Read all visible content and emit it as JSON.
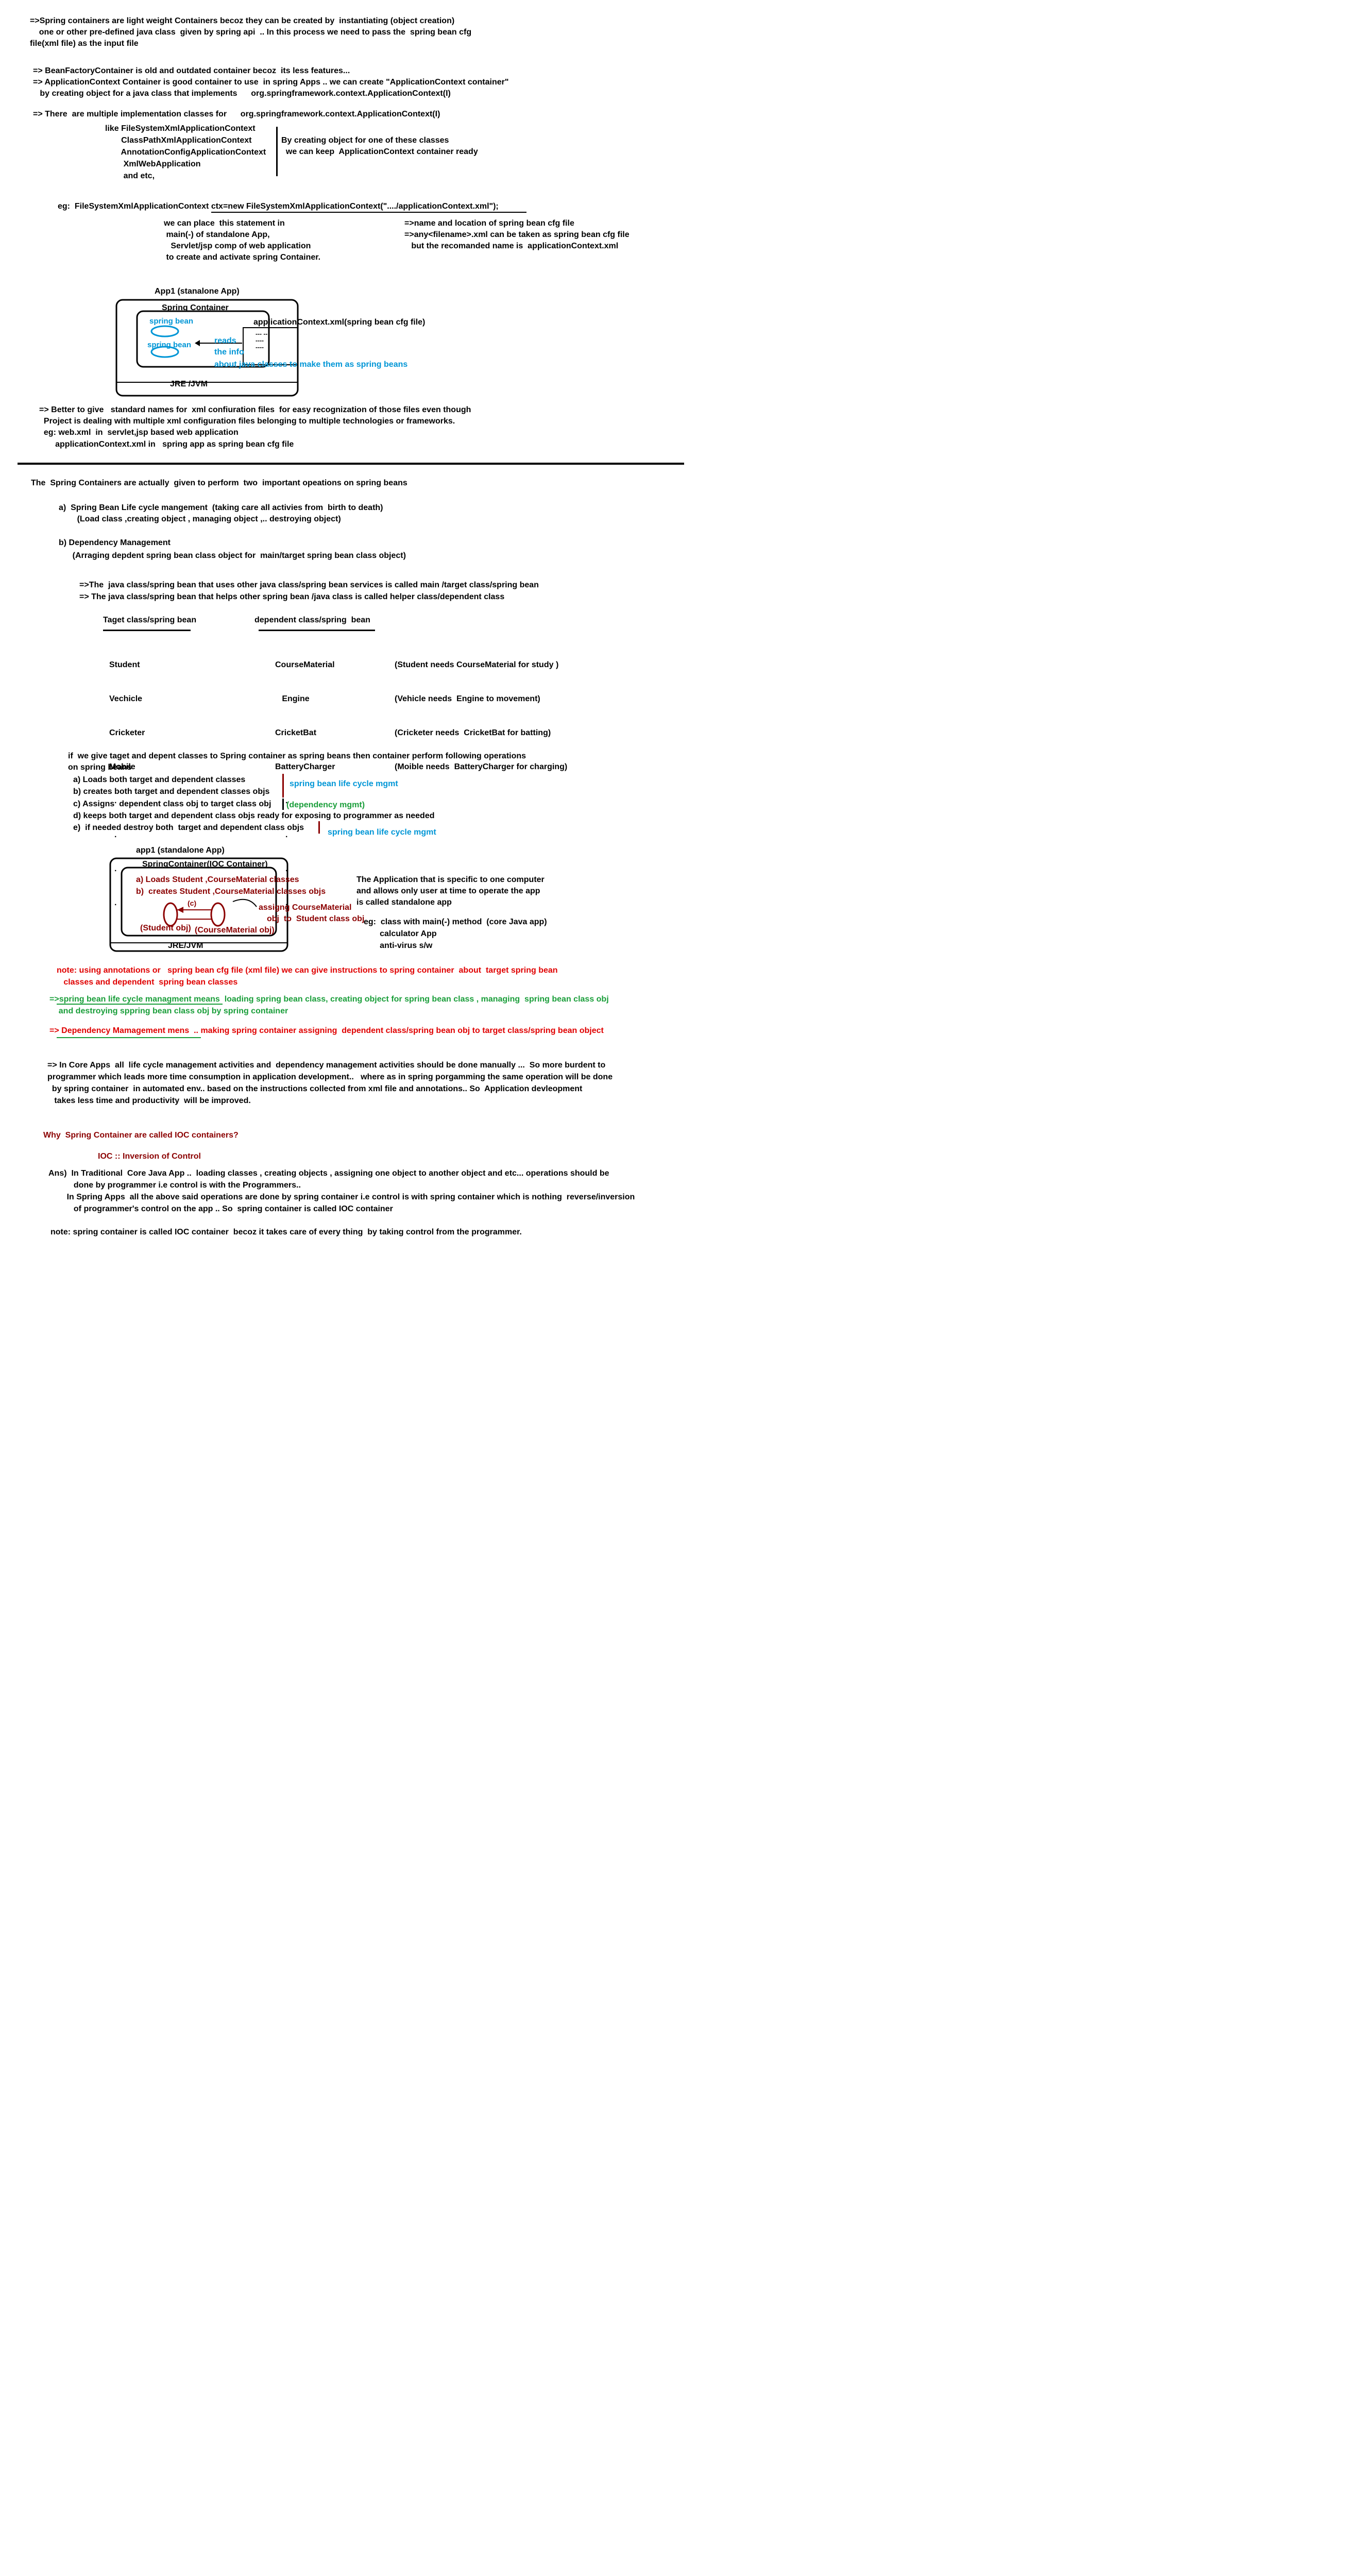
{
  "section1": {
    "intro": [
      "=>Spring containers are light weight Containers becoz they can be created by  instantiating (object creation)",
      "    one or other pre-defined java class  given by spring api  .. In this process we need to pass the  spring bean cfg",
      "file(xml file) as the input file"
    ],
    "bean_factory": [
      "=> BeanFactoryContainer is old and outdated container becoz  its less features...",
      "=> ApplicationContext Container is good container to use  in spring Apps .. we can create \"ApplicationContext container\"",
      "   by creating object for a java class that implements      org.springframework.context.ApplicationContext(I)"
    ],
    "multiple_impl": "=> There  are multiple implementation classes for      org.springframework.context.ApplicationContext(I)",
    "impl_classes": [
      "like FileSystemXmlApplicationContext",
      "       ClassPathXmlApplicationContext",
      "       AnnotationConfigApplicationContext",
      "        XmlWebApplication",
      "        and etc,"
    ],
    "impl_note": [
      "By creating object for one of these classes",
      "  we can keep  ApplicationContext container ready"
    ],
    "eg_statement": "eg:  FileSystemXmlApplicationContext ctx=new FileSystemXmlApplicationContext(\"..../applicationContext.xml\");",
    "eg_place": [
      "we can place  this statement in",
      " main(-) of standalone App,",
      "   Servlet/jsp comp of web application",
      " to create and activate spring Container."
    ],
    "eg_name": [
      "=>name and location of spring bean cfg file",
      "=>any<filename>.xml can be taken as spring bean cfg file",
      "   but the recomanded name is  applicationContext.xml"
    ],
    "diagram1": {
      "app_title": "App1 (stanalone App)",
      "container_label": "Spring Container",
      "bean1": "spring bean",
      "bean2": "spring bean",
      "xml_label": "applicationContext.xml(spring bean cfg file)",
      "reads": "reads",
      "the_info": "the info",
      "note": "about java classes to make them as spring beans",
      "xml_dots": "--- --\n---- \n----",
      "jre": "JRE /JVM"
    },
    "better_names": [
      "=> Better to give   standard names for  xml confiuration files  for easy recognization of those files even though",
      "  Project is dealing with multiple xml configuration files belonging to multiple technologies or frameworks.",
      "  eg: web.xml  in  servlet,jsp based web application",
      "       applicationContext.xml in   spring app as spring bean cfg file"
    ]
  },
  "section2": {
    "heading": "The  Spring Containers are actually  given to perform  two  important opeations on spring beans",
    "op_a": [
      "a)  Spring Bean Life cycle mangement  (taking care all activies from  birth to death)",
      "        (Load class ,creating object , managing object ,.. destroying object)"
    ],
    "op_b": [
      "b) Dependency Management",
      "      (Arraging depdent spring bean class object for  main/target spring bean class object)"
    ],
    "main_def": [
      "=>The  java class/spring bean that uses other java class/spring bean services is called main /target class/spring bean",
      "=> The java class/spring bean that helps other spring bean /java class is called helper class/dependent class"
    ],
    "table": {
      "col1_header": "Taget class/spring bean",
      "col2_header": "dependent class/spring  bean",
      "col1": [
        "Student",
        "Vechicle",
        "Cricketer",
        "Mobile",
        ".",
        ".",
        ".",
        "."
      ],
      "col2": [
        "CourseMaterial",
        "   Engine",
        "CricketBat",
        "BatteryCharger",
        ".",
        ".",
        ".",
        "."
      ],
      "col3": [
        "(Student needs CourseMaterial for study )",
        "(Vehicle needs  Engine to movement)",
        "(Cricketer needs  CricketBat for batting)",
        "(Moible needs  BatteryCharger for charging)"
      ]
    },
    "tasks_intro": [
      "if  we give taget and depent classes to Spring container as spring beans then container perform following operations",
      "on spring beans"
    ],
    "tasks": [
      "a) Loads both target and dependent classes",
      "b) creates both target and dependent classes objs",
      "c) Assigns  dependent class obj to target class obj",
      "d) keeps both target and dependent class objs ready for exposing to programmer as needed",
      "e)  if needed destroy both  target and dependent class objs"
    ],
    "task_notes": {
      "lifecycle1": "spring bean life cycle mgmt",
      "dependency": "(dependency mgmt)",
      "lifecycle2": "spring bean life cycle mgmt"
    },
    "diagram2": {
      "app_title": "app1 (standalone App)",
      "container_label": "SpringContainer(IOC Container)",
      "line_a": "a) Loads Student ,CourseMaterial classes",
      "line_b": "b)  creates Student ,CourseMaterial classes objs",
      "c_label": "(c)",
      "assign": "assigng CourseMaterial",
      "assign2": "obj  to  Student class obj",
      "student_obj": "(Student obj)",
      "course_obj": "(CourseMaterial obj)",
      "jre": "JRE/JVM"
    },
    "standalone_note": [
      "The Application that is specific to one computer",
      "and allows only user at time to operate the app",
      "is called standalone app"
    ],
    "standalone_eg": [
      "eg:  class with main(-) method  (core Java app)",
      "       calculator App",
      "       anti-virus s/w"
    ],
    "note_annotations": [
      "note: using annotations or   spring bean cfg file (xml file) we can give instructions to spring container  about  target spring bean",
      "   classes and dependent  spring bean classes"
    ],
    "lifecycle_means": [
      "=>spring bean life cycle managment means  loading spring bean class, creating object for spring bean class , managing  spring bean class obj",
      "    and destroying sppring bean class obj by spring container"
    ],
    "dependency_means": "=> Dependency Mamagement mens  .. making spring container assigning  dependent class/spring bean obj to target class/spring bean object",
    "core_apps": [
      "=> In Core Apps  all  life cycle management activities and  dependency management activities should be done manually ...  So more burdent to",
      "programmer which leads more time consumption in application development..   where as in spring porgamming the same operation will be done",
      "  by spring container  in automated env.. based on the instructions collected from xml file and annotations.. So  Application devleopment",
      "   takes less time and productivity  will be improved."
    ],
    "why_ioc": "Why  Spring Container are called IOC containers?",
    "ioc_def": "IOC :: Inversion of Control",
    "ans": [
      "Ans)  In Traditional  Core Java App ..  loading classes , creating objects , assigning one object to another object and etc... operations should be",
      "           done by programmer i.e control is with the Programmers..",
      "        In Spring Apps  all the above said operations are done by spring container i.e control is with spring container which is nothing  reverse/inversion",
      "           of programmer's control on the app .. So  spring container is called IOC container"
    ],
    "final_note": "note: spring container is called IOC container  becoz it takes care of every thing  by taking control from the programmer."
  }
}
